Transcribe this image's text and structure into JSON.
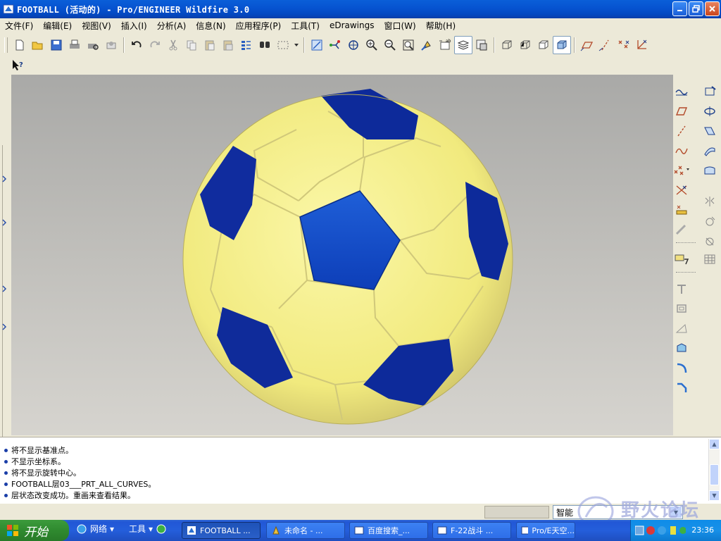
{
  "window": {
    "title": "FOOTBALL (活动的) - Pro/ENGINEER Wildfire 3.0"
  },
  "menu": [
    "文件(F)",
    "编辑(E)",
    "视图(V)",
    "插入(I)",
    "分析(A)",
    "信息(N)",
    "应用程序(P)",
    "工具(T)",
    "eDrawings",
    "窗口(W)",
    "帮助(H)"
  ],
  "toolbar": {
    "icons": [
      "new-file-icon",
      "open-folder-icon",
      "save-icon",
      "print-icon",
      "print-preview-icon",
      "send-mail-icon",
      "undo-icon",
      "redo-icon",
      "cut-icon",
      "copy-icon",
      "paste-icon",
      "paste-special-icon",
      "regenerate-icon",
      "find-icon",
      "select-box-icon",
      "repaint-icon",
      "spin-center-icon",
      "orient-icon",
      "zoom-in-icon",
      "zoom-out-icon",
      "refit-icon",
      "reorient-icon",
      "saved-views-icon",
      "layers-icon",
      "view-manager-icon",
      "wireframe-icon",
      "hidden-line-icon",
      "no-hidden-icon",
      "shading-icon",
      "datum-planes-icon",
      "datum-axes-icon",
      "datum-points-icon",
      "coordinate-systems-icon"
    ],
    "pressed": [
      "layers-icon",
      "shading-icon"
    ]
  },
  "messages": [
    "将不显示基准点。",
    "不显示坐标系。",
    "将不显示旋转中心。",
    "FOOTBALL层03___PRT_ALL_CURVES。",
    "层状态改变成功。重画来查看结果。"
  ],
  "status": {
    "filter_value": "智能"
  },
  "taskbar": {
    "start_label": "开始",
    "quicklaunch": [
      {
        "label": "网络"
      },
      {
        "label": "工具"
      }
    ],
    "tasks": [
      {
        "label": "FOOTBALL ...",
        "active": true
      },
      {
        "label": "未命名 - ...",
        "active": false
      },
      {
        "label": "百度搜索_...",
        "active": false
      },
      {
        "label": "F-22战斗 ...",
        "active": false
      },
      {
        "label": "Pro/E天空...",
        "active": false
      }
    ],
    "clock": "23:36"
  },
  "watermark": {
    "text": "野火论坛"
  },
  "colors": {
    "ball_yellow": "#f3ee8a",
    "ball_blue": "#0d2a9a",
    "title_blue": "#0a5fd8"
  }
}
